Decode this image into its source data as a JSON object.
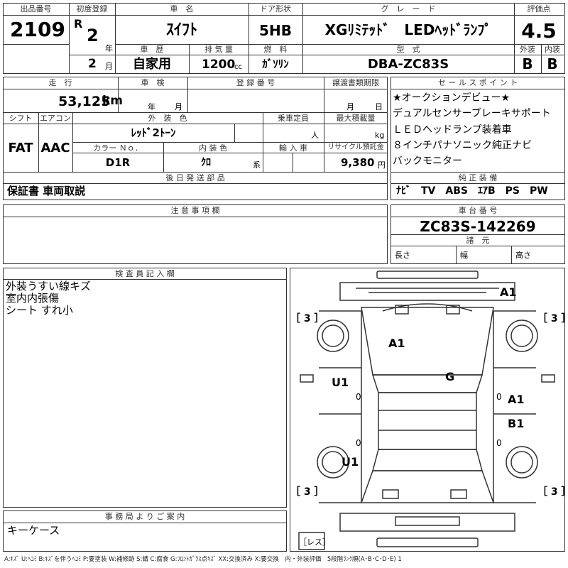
{
  "header": {
    "lot_no_label": "出品番号",
    "lot_no": "2109",
    "first_reg_label": "初度登録",
    "era_label": "R",
    "year": "2",
    "year_unit": "年",
    "month": "2",
    "month_unit": "月",
    "car_name_label": "車　名",
    "car_name": "ｽｲﾌﾄ",
    "door_label": "ドア形状",
    "door": "5HB",
    "grade_label": "グ　レ　ー　ド",
    "grade": "XGﾘﾐﾃｯﾄﾞ　LEDﾍｯﾄﾞﾗﾝﾌﾟ",
    "score_label": "評価点",
    "score": "4.5",
    "history_label": "車　歴",
    "history": "自家用",
    "displacement_label": "排 気 量",
    "displacement": "1200",
    "displacement_unit": "cc",
    "fuel_label": "燃　料",
    "fuel": "ｶﾞｿﾘﾝ",
    "model_label": "型　式",
    "model": "DBA-ZC83S",
    "ext_label": "外装",
    "ext": "B",
    "int_label": "内装",
    "int": "B"
  },
  "row2": {
    "mileage_label": "走　行",
    "mileage": "53,125",
    "mileage_unit": "km",
    "inspection_label": "車　検",
    "year_unit": "年",
    "month_unit": "月",
    "reg_no_label": "登 録 番 号",
    "transfer_label": "譲渡書類期限",
    "transfer_month": "月",
    "transfer_day": "日",
    "shift_label": "シフト",
    "shift": "FAT",
    "ac_label": "エアコン",
    "ac": "AAC",
    "ext_color_label": "外　装　色",
    "ext_color": "ﾚｯﾄﾞ2ﾄｰﾝ",
    "capacity_label": "乗車定員",
    "capacity_unit": "人",
    "load_label": "最大積載量",
    "load_unit": "kg",
    "color_no_label": "カラー Ｎｏ．",
    "color_no": "D1R",
    "int_color_label": "内 装 色",
    "int_color": "ｸﾛ",
    "int_color_unit": "系",
    "import_label": "輸 入 車",
    "recycle_label": "リサイクル預託金",
    "recycle": "9,380",
    "recycle_unit": "円",
    "later_label": "後 日 発 送 部 品",
    "later": "保証書 車両取説"
  },
  "sales": {
    "label": "セ ー ル ス ポ イ ン ト",
    "points": [
      "★オークションデビュー★",
      "デュアルセンサーブレーキサポート",
      "ＬＥＤヘッドランプ装着車",
      "８インチパナソニック純正ナビ",
      "バックモニター"
    ],
    "equip_label": "純 正 装 備",
    "equip": "ﾅﾋﾞ　TV　ABS　ｴｱB　PS　PW"
  },
  "notes": {
    "label": "注 意 事 項 欄",
    "chassis_label": "車 台 番 号",
    "chassis": "ZC83S-142269",
    "specs_label": "諸　元",
    "length_label": "長さ",
    "width_label": "幅",
    "height_label": "高さ"
  },
  "inspector": {
    "label": "検 査 員 記 入 欄",
    "lines": [
      "外装うすい線キズ",
      "室内内張傷",
      "シート すれ小"
    ]
  },
  "office": {
    "label": "事 務 局 よ り ご 案 内",
    "text": "キーケース"
  },
  "diagram": {
    "marks": [
      "A1",
      "A1",
      "G",
      "U1",
      "A1",
      "B1",
      "U1"
    ],
    "bracket_tl": "［ 3 ］",
    "bracket_tr": "［ 3 ］",
    "bracket_bl": "［ 3 ］",
    "bracket_br": "［ 3 ］",
    "zero": "0",
    "spare": "［レス］"
  },
  "legend": "A:ｷｽﾞ U:ﾍｺﾐ B:ｷｽﾞを伴うﾍｺﾐ P:要塗装 W:補修跡 S:錆 C:腐食 G:ﾌﾛﾝﾄｶﾞﾗｽ点ｷｽﾞ XX:交換済み X:要交換　内・外装評価　5段階ﾗﾝｸ順(A･B･C･D･E) 1"
}
